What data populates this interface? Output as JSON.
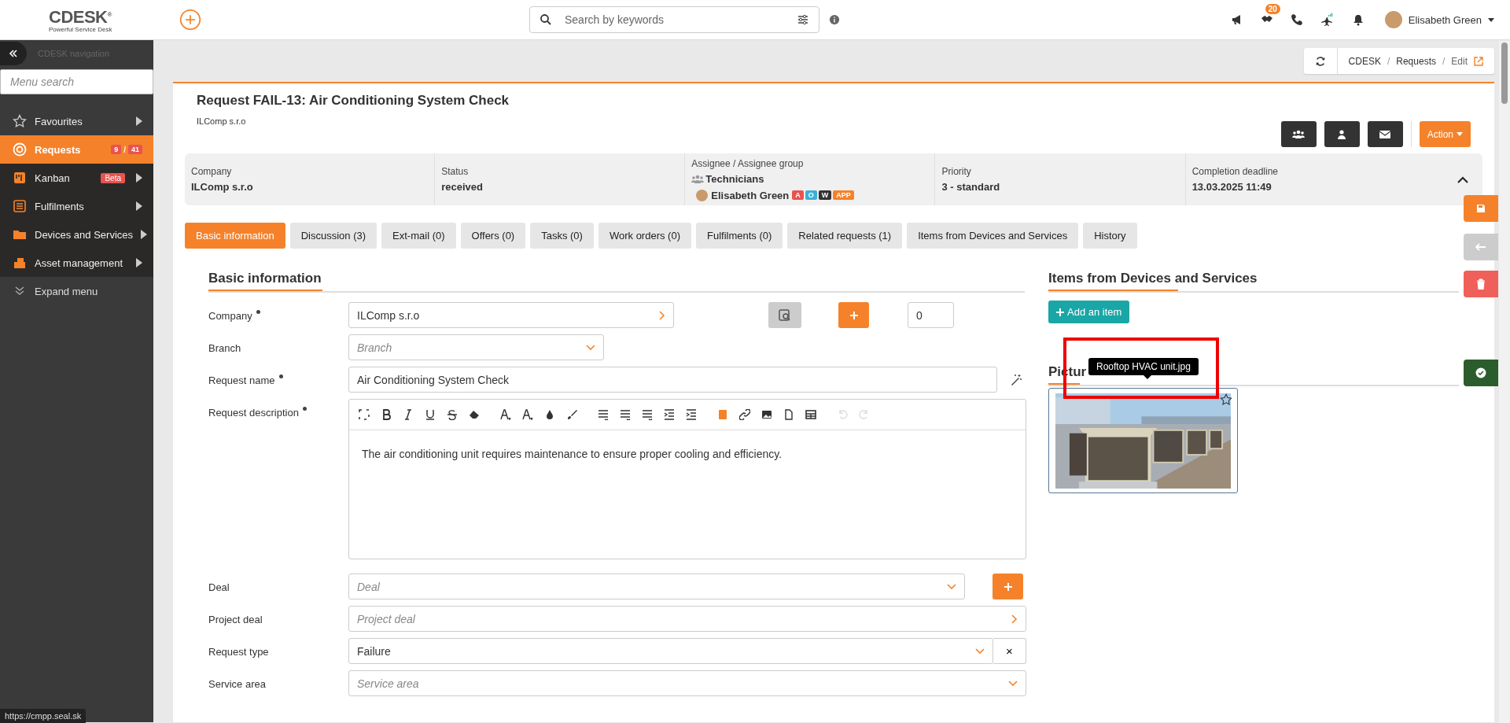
{
  "app": {
    "logo": "CDESK",
    "logo_mark": "®",
    "tagline": "Powerful Service Desk"
  },
  "search": {
    "placeholder": "Search by keywords"
  },
  "notifications_count": "20",
  "user": {
    "name": "Elisabeth Green"
  },
  "sidebar": {
    "title": "CDESK navigation",
    "search_placeholder": "Menu search",
    "expand": "Expand menu",
    "items": [
      {
        "label": "Favourites",
        "selected": false,
        "expandable": true
      },
      {
        "label": "Requests",
        "selected": true,
        "expandable": false,
        "counts": [
          "9",
          "41"
        ],
        "separator": "/"
      },
      {
        "label": "Kanban",
        "selected": false,
        "expandable": true,
        "badge": "Beta"
      },
      {
        "label": "Fulfilments",
        "selected": false,
        "expandable": true
      },
      {
        "label": "Devices and Services",
        "selected": false,
        "expandable": true
      },
      {
        "label": "Asset management",
        "selected": false,
        "expandable": true
      }
    ]
  },
  "breadcrumb": {
    "items": [
      "CDESK",
      "Requests",
      "Edit"
    ],
    "separator": "/"
  },
  "request": {
    "title": "Request FAIL-13: Air Conditioning System Check",
    "company": "ILComp s.r.o",
    "action": "Action"
  },
  "summary": [
    {
      "kind": "text",
      "label": "Company",
      "value": "ILComp s.r.o"
    },
    {
      "kind": "text",
      "label": "Status",
      "value": "received"
    },
    {
      "kind": "assignee",
      "label": "Assignee / Assignee group",
      "group": "Technicians",
      "person": "Elisabeth Green",
      "tags": [
        {
          "text": "A",
          "color": "#e8534f"
        },
        {
          "text": "O",
          "color": "#3bb0d8"
        },
        {
          "text": "W",
          "color": "#333333"
        },
        {
          "text": "APP",
          "color": "#f5822a"
        }
      ]
    },
    {
      "kind": "text",
      "label": "Priority",
      "value": "3 - standard"
    },
    {
      "kind": "text",
      "label": "Completion deadline",
      "value": "13.03.2025 11:49"
    }
  ],
  "tabs": [
    {
      "label": "Basic information",
      "selected": true
    },
    {
      "label": "Discussion (3)",
      "selected": false
    },
    {
      "label": "Ext-mail (0)",
      "selected": false
    },
    {
      "label": "Offers (0)",
      "selected": false
    },
    {
      "label": "Tasks (0)",
      "selected": false
    },
    {
      "label": "Work orders (0)",
      "selected": false
    },
    {
      "label": "Fulfilments (0)",
      "selected": false
    },
    {
      "label": "Related requests (1)",
      "selected": false
    },
    {
      "label": "Items from Devices and Services",
      "selected": false
    },
    {
      "label": "History",
      "selected": false
    }
  ],
  "form": {
    "title": "Basic information",
    "fields": [
      {
        "kind": "lookup",
        "label": "Company",
        "required": true,
        "value": "ILComp s.r.o",
        "count": "0"
      },
      {
        "kind": "select",
        "label": "Branch",
        "required": false,
        "placeholder": "Branch"
      },
      {
        "kind": "text",
        "label": "Request name",
        "required": true,
        "value": "Air Conditioning System Check"
      },
      {
        "kind": "editor",
        "label": "Request description",
        "required": true,
        "value": "The air conditioning unit requires maintenance to ensure proper cooling and efficiency."
      },
      {
        "kind": "select",
        "label": "Deal",
        "required": false,
        "placeholder": "Deal"
      },
      {
        "kind": "lookup",
        "label": "Project deal",
        "required": false,
        "placeholder": "Project deal"
      },
      {
        "kind": "select",
        "label": "Request type",
        "required": false,
        "value": "Failure",
        "clear": "×"
      },
      {
        "kind": "select",
        "label": "Service area",
        "required": false,
        "placeholder": "Service area"
      }
    ]
  },
  "items_section": {
    "title": "Items from Devices and Services",
    "button": "Add an item"
  },
  "gallery": {
    "title": "Pictur",
    "tooltip": "Rooftop HVAC unit.jpg",
    "favourite": false
  },
  "status_url": "https://cmpp.seal.sk"
}
